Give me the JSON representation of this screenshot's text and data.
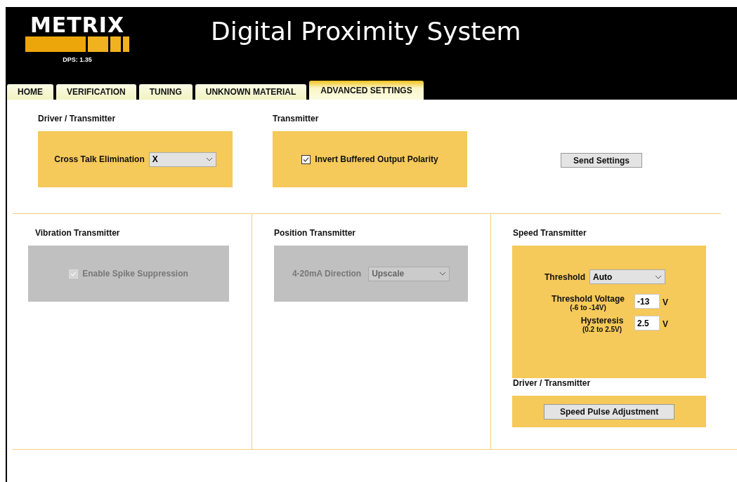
{
  "header": {
    "logo": "METRIX",
    "version": "DPS: 1.35",
    "title": "Digital Proximity System"
  },
  "tabs": [
    {
      "label": "HOME",
      "selected": false
    },
    {
      "label": "VERIFICATION",
      "selected": false
    },
    {
      "label": "TUNING",
      "selected": false
    },
    {
      "label": "UNKNOWN MATERIAL",
      "selected": false
    },
    {
      "label": "ADVANCED SETTINGS",
      "selected": true
    }
  ],
  "top_panels": [
    {
      "heading": "Driver / Transmitter",
      "kind": "select",
      "label": "Cross Talk Elimination",
      "value": "X",
      "disabled": false
    },
    {
      "heading": "Transmitter",
      "kind": "checkbox",
      "label": "Invert Buffered Output Polarity",
      "checked": true,
      "disabled": false
    }
  ],
  "send_button": "Send Settings",
  "columns": [
    {
      "heading": "Vibration Transmitter",
      "kind": "checkbox",
      "label": "Enable Spike Suppression",
      "checked": true,
      "disabled": true
    },
    {
      "heading": "Position Transmitter",
      "kind": "select",
      "label": "4-20mA Direction",
      "value": "Upscale",
      "disabled": true
    }
  ],
  "speed": {
    "heading": "Speed Transmitter",
    "threshold_label": "Threshold",
    "threshold_value": "Auto",
    "fields": [
      {
        "label": "Threshold Voltage",
        "range": "(-6 to -14V)",
        "value": "-13",
        "unit": "V"
      },
      {
        "label": "Hysteresis",
        "range": "(0.2 to 2.5V)",
        "value": "2.5",
        "unit": "V"
      }
    ],
    "driver_heading": "Driver / Transmitter",
    "pulse_button": "Speed Pulse Adjustment"
  }
}
